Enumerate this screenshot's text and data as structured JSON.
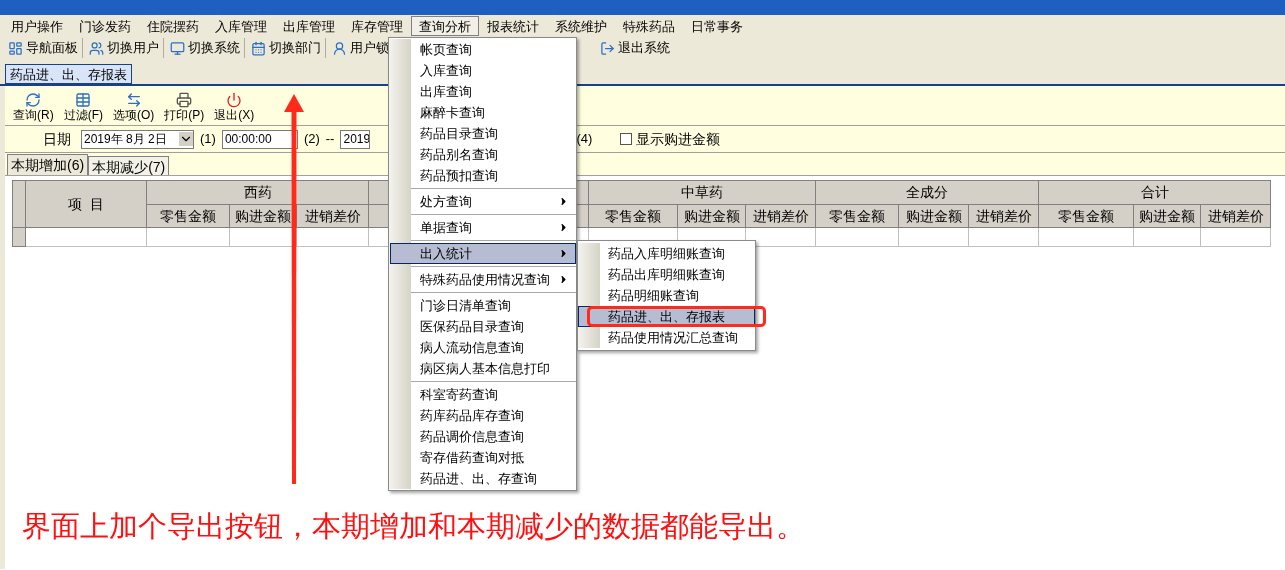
{
  "menu_bar": [
    {
      "label": "用户操作",
      "selected": false
    },
    {
      "label": "门诊发药",
      "selected": false
    },
    {
      "label": "住院摆药",
      "selected": false
    },
    {
      "label": "入库管理",
      "selected": false
    },
    {
      "label": "出库管理",
      "selected": false
    },
    {
      "label": "库存管理",
      "selected": false
    },
    {
      "label": "查询分析",
      "selected": true
    },
    {
      "label": "报表统计",
      "selected": false
    },
    {
      "label": "系统维护",
      "selected": false
    },
    {
      "label": "特殊药品",
      "selected": false
    },
    {
      "label": "日常事务",
      "selected": false
    }
  ],
  "toolbar": [
    {
      "label": "导航面板"
    },
    {
      "label": "切换用户"
    },
    {
      "label": "切换系统"
    },
    {
      "label": "切换部门"
    },
    {
      "label": "用户锁"
    }
  ],
  "toolbar_right": {
    "label": "退出系统"
  },
  "document_tabs": [
    {
      "label": "药品进、出、存报表",
      "selected": true
    }
  ],
  "report_toolbar": [
    {
      "label": "查询(R)",
      "kind": "refresh"
    },
    {
      "label": "过滤(F)",
      "kind": "filter"
    },
    {
      "label": "选项(O)",
      "kind": "options"
    },
    {
      "label": "打印(P)",
      "kind": "print"
    },
    {
      "label": "退出(X)",
      "kind": "exit"
    }
  ],
  "date_row": {
    "label": "日期",
    "start_date": "2019年 8月 2日",
    "mark_1": "(1)",
    "start_time": "00:00:00",
    "mark_2": "(2)",
    "separator": "--",
    "end_date": "2019",
    "mark_4": "(4)",
    "checkbox": {
      "label": "显示购进金额",
      "checked": false
    }
  },
  "sub_tabs": [
    {
      "label": "本期增加(6)",
      "selected": true
    },
    {
      "label": "本期减少(7)",
      "selected": false
    }
  ],
  "table": {
    "item_header": "项  目",
    "groups": [
      {
        "kind": "group",
        "label": "西药",
        "columns": [
          "零售金额",
          "购进金额",
          "进销差价"
        ]
      },
      {
        "kind": "covered"
      },
      {
        "kind": "group",
        "label": "中草药",
        "columns": [
          "零售金额",
          "购进金额",
          "进销差价"
        ]
      },
      {
        "kind": "group",
        "label": "全成分",
        "columns": [
          "零售金额",
          "购进金额",
          "进销差价"
        ]
      },
      {
        "kind": "group",
        "label": "合计",
        "columns": [
          "零售金额",
          "购进金额",
          "进销差价"
        ]
      }
    ]
  },
  "dropdown_menu": {
    "groups": [
      [
        {
          "label": "帐页查询",
          "submenu": false,
          "selected": false
        },
        {
          "label": "入库查询",
          "submenu": false,
          "selected": false
        },
        {
          "label": "出库查询",
          "submenu": false,
          "selected": false
        },
        {
          "label": "麻醉卡查询",
          "submenu": false,
          "selected": false
        },
        {
          "label": "药品目录查询",
          "submenu": false,
          "selected": false
        },
        {
          "label": "药品别名查询",
          "submenu": false,
          "selected": false
        },
        {
          "label": "药品预扣查询",
          "submenu": false,
          "selected": false
        }
      ],
      [
        {
          "label": "处方查询",
          "submenu": true,
          "selected": false
        }
      ],
      [
        {
          "label": "单据查询",
          "submenu": true,
          "selected": false
        }
      ],
      [
        {
          "label": "出入统计",
          "submenu": true,
          "selected": true
        }
      ],
      [
        {
          "label": "特殊药品使用情况查询",
          "submenu": true,
          "selected": false
        }
      ],
      [
        {
          "label": "门诊日清单查询",
          "submenu": false,
          "selected": false
        },
        {
          "label": "医保药品目录查询",
          "submenu": false,
          "selected": false
        },
        {
          "label": "病人流动信息查询",
          "submenu": false,
          "selected": false
        },
        {
          "label": "病区病人基本信息打印",
          "submenu": false,
          "selected": false
        }
      ],
      [
        {
          "label": "科室寄药查询",
          "submenu": false,
          "selected": false
        },
        {
          "label": "药库药品库存查询",
          "submenu": false,
          "selected": false
        },
        {
          "label": "药品调价信息查询",
          "submenu": false,
          "selected": false
        },
        {
          "label": "寄存借药查询对抵",
          "submenu": false,
          "selected": false
        },
        {
          "label": "药品进、出、存查询",
          "submenu": false,
          "selected": false
        }
      ]
    ]
  },
  "submenu": [
    {
      "label": "药品入库明细账查询",
      "selected": false
    },
    {
      "label": "药品出库明细账查询",
      "selected": false
    },
    {
      "label": "药品明细账查询",
      "selected": false
    },
    {
      "label": "药品进、出、存报表",
      "selected": true
    },
    {
      "label": "药品使用情况汇总查询",
      "selected": false
    }
  ],
  "annotation": {
    "text": "界面上加个导出按钮，本期增加和本期减少的数据都能导出。"
  }
}
